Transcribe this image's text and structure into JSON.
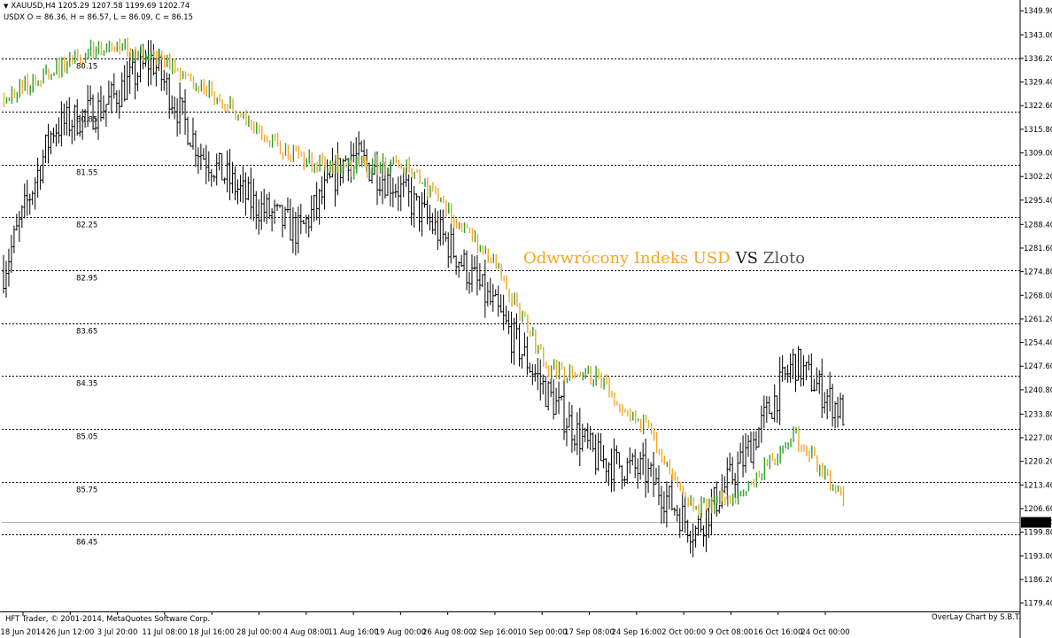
{
  "header": {
    "main_symbol_line": "XAUUSD,H4  1205.29 1207.58 1199.69 1202.74",
    "overlay_symbol_line": "USDX O = 86.36, H = 86.57, L = 86.09, C = 86.15"
  },
  "overlay_title": {
    "left": "Odwwrócony Indeks USD",
    "vs": "VS",
    "right": "Zloto"
  },
  "footer": {
    "copyright": "HFT Trader, © 2001-2014, MetaQuotes Software Corp.",
    "overlay_credit": "OverLay Chart by S.B.T."
  },
  "colors": {
    "background": "#ffffff",
    "gold_bars": "#000000",
    "usdx_up": "#2ca02c",
    "usdx_down": "#f5a623",
    "grid": "#000000",
    "current_price_line": "#b0b0b0"
  },
  "chart_data": {
    "type": "bar",
    "title": "Odwwrócony Indeks USD VS Zloto",
    "price_axis": {
      "labels": [
        "1349.90",
        "1343.00",
        "1336.20",
        "1329.40",
        "1322.60",
        "1315.80",
        "1309.00",
        "1302.20",
        "1295.40",
        "1288.40",
        "1281.60",
        "1274.80",
        "1268.00",
        "1261.20",
        "1254.40",
        "1247.60",
        "1240.80",
        "1233.80",
        "1227.00",
        "1220.20",
        "1213.40",
        "1206.60",
        "1199.80",
        "1193.00",
        "1186.20",
        "1179.40"
      ],
      "range": [
        1177.0,
        1352.0
      ]
    },
    "usdx_inverted_axis": {
      "labels": [
        "80.15",
        "80.85",
        "81.55",
        "82.25",
        "82.95",
        "83.65",
        "84.35",
        "85.05",
        "85.75",
        "86.45"
      ],
      "grid": "dashed"
    },
    "time_axis": {
      "labels": [
        "18 Jun 2014",
        "26 Jun 12:00",
        "3 Jul 20:00",
        "11 Jul 08:00",
        "18 Jul 16:00",
        "28 Jul 00:00",
        "4 Aug 08:00",
        "11 Aug 16:00",
        "19 Aug 00:00",
        "26 Aug 08:00",
        "2 Sep 16:00",
        "10 Sep 00:00",
        "17 Sep 08:00",
        "24 Sep 16:00",
        "2 Oct 00:00",
        "9 Oct 08:00",
        "16 Oct 16:00",
        "24 Oct 00:00"
      ]
    },
    "current_price": "1202.74",
    "series": [
      {
        "name": "XAUUSD,H4",
        "style": "ohlc-bars",
        "x": [
          "18 Jun 2014",
          "26 Jun 12:00",
          "3 Jul 20:00",
          "11 Jul 08:00",
          "18 Jul 16:00",
          "28 Jul 00:00",
          "4 Aug 08:00",
          "11 Aug 16:00",
          "19 Aug 00:00",
          "26 Aug 08:00",
          "2 Sep 16:00",
          "10 Sep 00:00",
          "17 Sep 08:00",
          "24 Sep 16:00",
          "2 Oct 00:00",
          "9 Oct 08:00",
          "16 Oct 16:00",
          "24 Oct 00:00"
        ],
        "close": [
          1275,
          1316,
          1322,
          1336,
          1309,
          1295,
          1286,
          1309,
          1299,
          1283,
          1263,
          1240,
          1221,
          1217,
          1200,
          1221,
          1249,
          1234
        ],
        "last": {
          "open": 1205.29,
          "high": 1207.58,
          "low": 1199.69,
          "close": 1202.74
        }
      },
      {
        "name": "USDX",
        "style": "inverted-overlay",
        "x": [
          "18 Jun 2014",
          "26 Jun 12:00",
          "3 Jul 20:00",
          "11 Jul 08:00",
          "18 Jul 16:00",
          "28 Jul 00:00",
          "4 Aug 08:00",
          "11 Aug 16:00",
          "19 Aug 00:00",
          "26 Aug 08:00",
          "2 Sep 16:00",
          "10 Sep 00:00",
          "17 Sep 08:00",
          "24 Sep 16:00",
          "2 Oct 00:00",
          "9 Oct 08:00",
          "16 Oct 16:00",
          "24 Oct 00:00"
        ],
        "values": [
          80.65,
          80.3,
          80.0,
          80.1,
          80.5,
          81.0,
          81.5,
          81.6,
          81.5,
          82.15,
          82.9,
          84.25,
          84.35,
          85.05,
          86.1,
          85.9,
          85.1,
          86.0
        ],
        "last": {
          "open": 86.36,
          "high": 86.57,
          "low": 86.09,
          "close": 86.15
        }
      }
    ]
  }
}
